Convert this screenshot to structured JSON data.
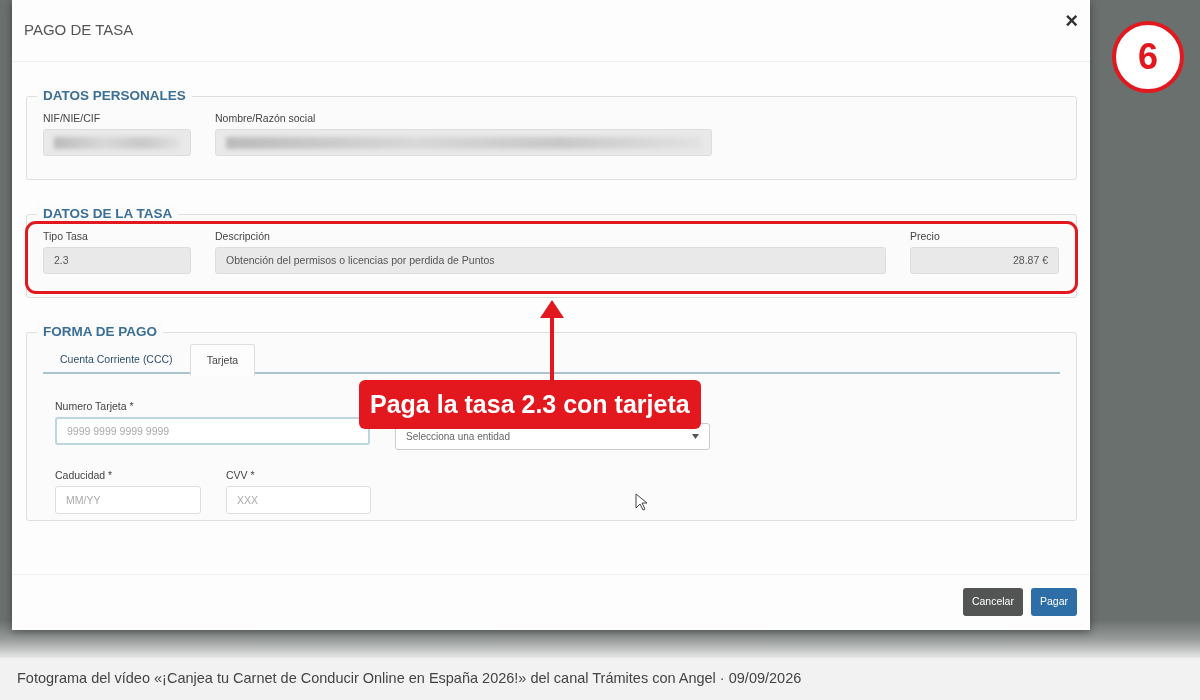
{
  "dialog": {
    "title": "PAGO DE TASA",
    "close": "×"
  },
  "personal": {
    "legend": "DATOS PERSONALES",
    "fields": [
      {
        "label": "NIF/NIE/CIF",
        "redacted": true
      },
      {
        "label": "Nombre/Razón social",
        "redacted": true
      }
    ]
  },
  "fee": {
    "legend": "DATOS DE LA TASA",
    "fields": [
      {
        "label": "Tipo Tasa",
        "value": "2.3",
        "kind": "text"
      },
      {
        "label": "Descripción",
        "value": "Obtención del permisos o licencias por perdida de Puntos",
        "kind": "text"
      },
      {
        "label": "Precio",
        "value": "28.87 €",
        "kind": "amount"
      }
    ]
  },
  "payment": {
    "legend": "FORMA DE PAGO",
    "tabs": [
      {
        "label": "Cuenta Corriente (CCC)",
        "selected": false
      },
      {
        "label": "Tarjeta",
        "selected": true
      }
    ],
    "fields": [
      {
        "kind": "input",
        "label": "Numero Tarjeta *",
        "placeholder": "9999 9999 9999 9999",
        "focused": true
      },
      {
        "kind": "select",
        "value": "Selecciona una entidad"
      },
      {
        "kind": "input",
        "label": "Caducidad *",
        "placeholder": "MM/YY",
        "focused": false
      },
      {
        "kind": "input",
        "label": "CVV *",
        "placeholder": "XXX",
        "focused": false
      }
    ]
  },
  "buttons": [
    {
      "label": "Cancelar",
      "kind": "secondary"
    },
    {
      "label": "Pagar",
      "kind": "primary"
    }
  ],
  "annotation": {
    "step": "6",
    "callout": "Paga la tasa 2.3 con tarjeta"
  },
  "caption": "Fotograma del vídeo «¡Canjea tu Carnet de Conducir Online en España 2026!» del canal Trámites con Angel · 09/09/2026"
}
